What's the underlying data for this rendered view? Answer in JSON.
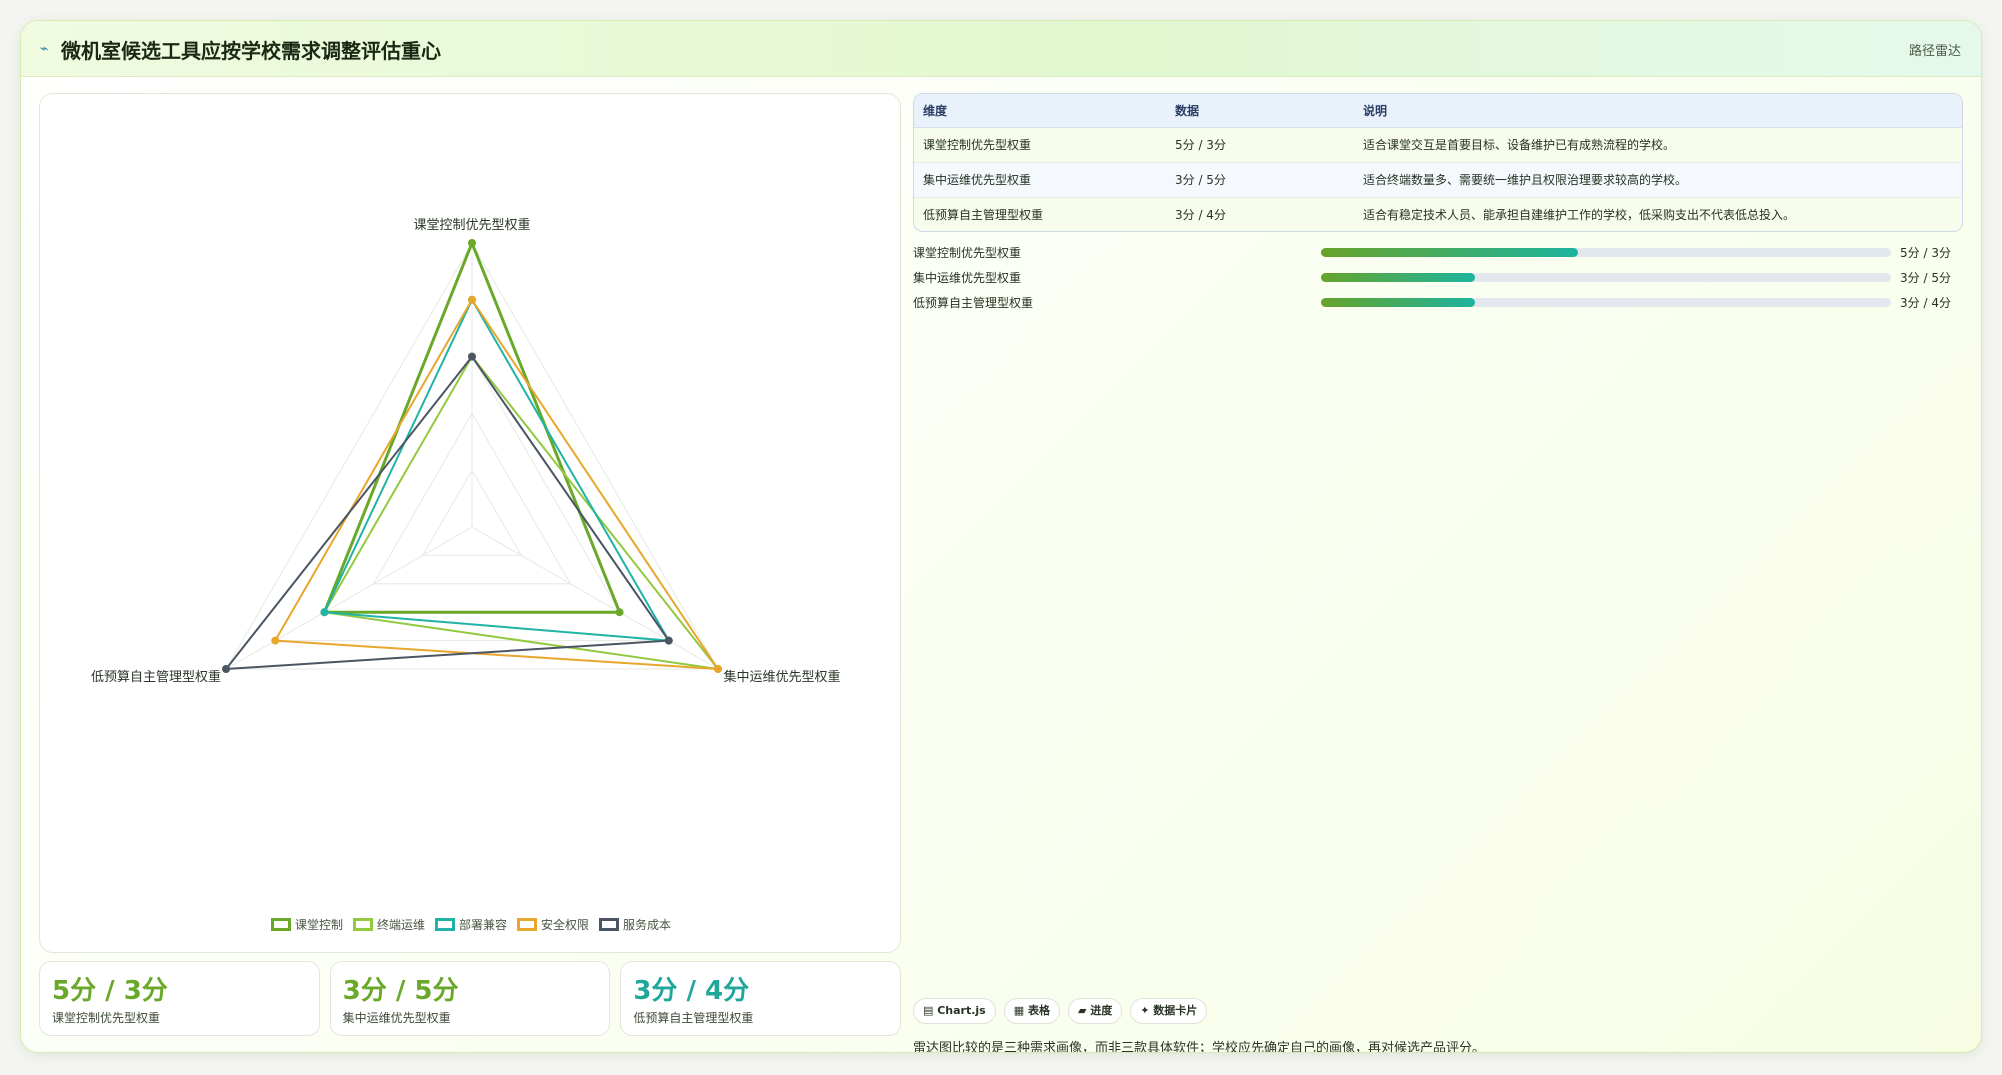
{
  "header": {
    "icon": "chart-line-icon",
    "title": "微机室候选工具应按学校需求调整评估重心",
    "tag": "路径雷达"
  },
  "chart_data": {
    "type": "radar",
    "axes": [
      "课堂控制优先型权重",
      "集中运维优先型权重",
      "低预算自主管理型权重"
    ],
    "rmax": 5,
    "levels": 5,
    "series": [
      {
        "name": "课堂控制",
        "color": "#6aa82a",
        "width": 3,
        "values": [
          5,
          3,
          3
        ]
      },
      {
        "name": "终端运维",
        "color": "#93c93f",
        "width": 2,
        "values": [
          3,
          5,
          3
        ]
      },
      {
        "name": "部署兼容",
        "color": "#20b3a6",
        "width": 2,
        "values": [
          4,
          4,
          3
        ]
      },
      {
        "name": "安全权限",
        "color": "#e8a62c",
        "width": 2,
        "values": [
          4,
          5,
          4
        ]
      },
      {
        "name": "服务成本",
        "color": "#4b5563",
        "width": 2,
        "values": [
          3,
          4,
          5
        ]
      }
    ]
  },
  "table": {
    "headers": [
      "维度",
      "数据",
      "说明"
    ],
    "rows": [
      {
        "dim": "课堂控制优先型权重",
        "data": "5分 / 3分",
        "desc": "适合课堂交互是首要目标、设备维护已有成熟流程的学校。"
      },
      {
        "dim": "集中运维优先型权重",
        "data": "3分 / 5分",
        "desc": "适合终端数量多、需要统一维护且权限治理要求较高的学校。"
      },
      {
        "dim": "低预算自主管理型权重",
        "data": "3分 / 4分",
        "desc": "适合有稳定技术人员、能承担自建维护工作的学校，低采购支出不代表低总投入。"
      }
    ]
  },
  "progress": [
    {
      "label": "课堂控制优先型权重",
      "value": "5分 / 3分",
      "fraction": 0.45
    },
    {
      "label": "集中运维优先型权重",
      "value": "3分 / 5分",
      "fraction": 0.27
    },
    {
      "label": "低预算自主管理型权重",
      "value": "3分 / 4分",
      "fraction": 0.27
    }
  ],
  "kpis": [
    {
      "value": "5分 / 3分",
      "label": "课堂控制优先型权重",
      "color": "#6aa82a"
    },
    {
      "value": "3分 / 5分",
      "label": "集中运维优先型权重",
      "color": "#6aa82a"
    },
    {
      "value": "3分 / 4分",
      "label": "低预算自主管理型权重",
      "color": "#20a79a"
    }
  ],
  "chips": [
    {
      "icon": "chart-icon",
      "label": "▤ Chart.js"
    },
    {
      "icon": "table-icon",
      "label": "▦ 表格"
    },
    {
      "icon": "progress-icon",
      "label": "▰ 进度"
    },
    {
      "icon": "card-icon",
      "label": "✦ 数据卡片"
    }
  ],
  "note": "雷达图比较的是三种需求画像，而非三款具体软件；学校应先确定自己的画像，再对候选产品评分。"
}
